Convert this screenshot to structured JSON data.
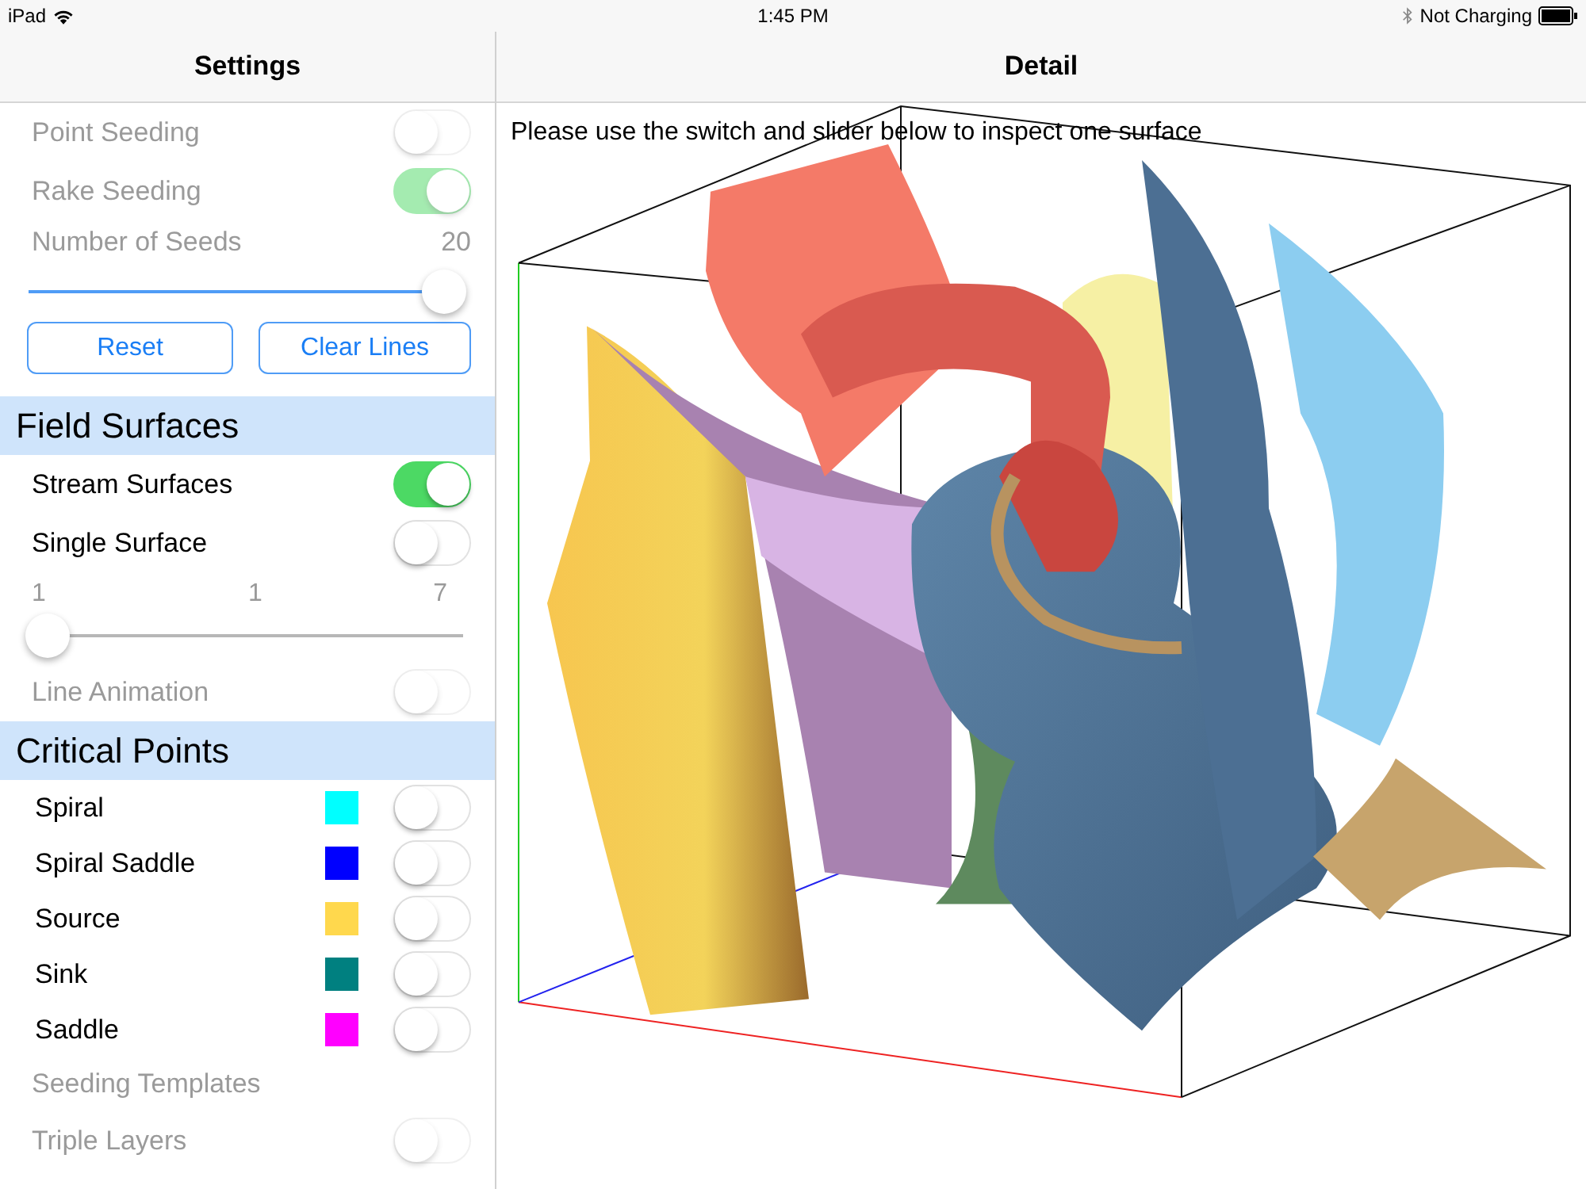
{
  "status_bar": {
    "device": "iPad",
    "time": "1:45 PM",
    "battery_text": "Not Charging"
  },
  "sidebar": {
    "title": "Settings",
    "items": [
      {
        "kind": "toggle",
        "label": "Point Seeding",
        "on": false,
        "disabled": true
      },
      {
        "kind": "toggle",
        "label": "Rake Seeding",
        "on": true,
        "disabled": true
      },
      {
        "kind": "value-slider",
        "label": "Number of Seeds",
        "value": "20",
        "level": 1,
        "disabled": true
      },
      {
        "kind": "buttons",
        "buttons": [
          "Reset",
          "Clear Lines"
        ]
      },
      {
        "kind": "header",
        "label": "Field Surfaces"
      },
      {
        "kind": "toggle",
        "label": "Stream Surfaces",
        "on": true,
        "disabled": false
      },
      {
        "kind": "toggle",
        "label": "Single Surface",
        "on": false,
        "disabled": false
      },
      {
        "kind": "range-slider",
        "min_label": "1",
        "value_label": "1",
        "max_label": "7",
        "level": 0
      },
      {
        "kind": "toggle",
        "label": "Line Animation",
        "on": false,
        "disabled": true
      },
      {
        "kind": "header",
        "label": "Critical Points"
      },
      {
        "kind": "color-toggle",
        "label": "Spiral",
        "color": "#00ffff",
        "on": false
      },
      {
        "kind": "color-toggle",
        "label": "Spiral Saddle",
        "color": "#0000ff",
        "on": false
      },
      {
        "kind": "color-toggle",
        "label": "Source",
        "color": "#ffd84d",
        "on": false
      },
      {
        "kind": "color-toggle",
        "label": "Sink",
        "color": "#008080",
        "on": false
      },
      {
        "kind": "color-toggle",
        "label": "Saddle",
        "color": "#ff00ff",
        "on": false
      },
      {
        "kind": "label",
        "label": "Seeding Templates",
        "disabled": true
      },
      {
        "kind": "toggle",
        "label": "Triple Layers",
        "on": false,
        "disabled": true
      }
    ]
  },
  "detail": {
    "title": "Detail",
    "instruction": "Please use the switch and slider below to inspect one surface"
  }
}
